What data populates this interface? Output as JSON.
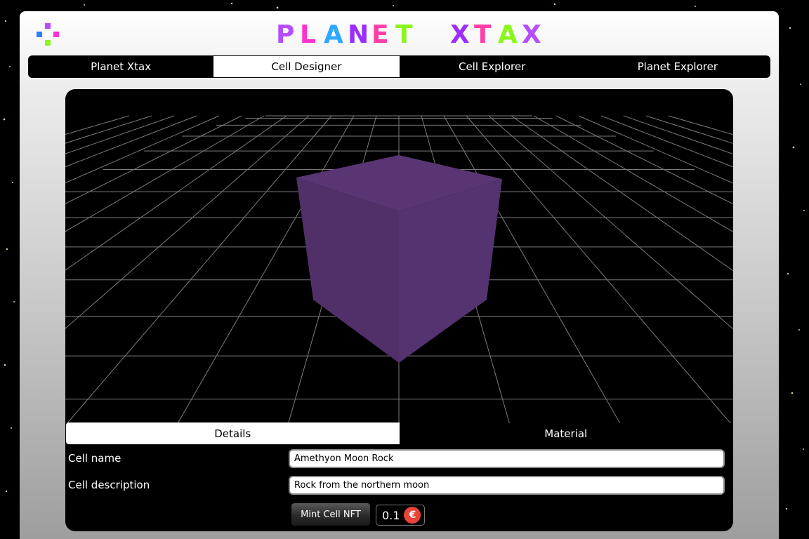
{
  "brand": {
    "title_left": "PLANET",
    "title_right": "XTAX",
    "title_colors": [
      "#b54dff",
      "#ff2fd0",
      "#2ea8ff",
      "#9b2dff",
      "#ff3fa8",
      "#8cf51a"
    ]
  },
  "nav": {
    "tabs": [
      {
        "label": "Planet Xtax",
        "active": false
      },
      {
        "label": "Cell Designer",
        "active": true
      },
      {
        "label": "Cell Explorer",
        "active": false
      },
      {
        "label": "Planet Explorer",
        "active": false
      }
    ]
  },
  "viewer": {
    "cube_color": "#52306b",
    "grid_color": "#7c7c7c"
  },
  "subtabs": [
    {
      "label": "Details",
      "active": true
    },
    {
      "label": "Material",
      "active": false
    }
  ],
  "form": {
    "name_label": "Cell name",
    "name_value": "Amethyon Moon Rock",
    "description_label": "Cell description",
    "description_value": "Rock from the northern moon",
    "mint_label": "Mint Cell NFT",
    "price": "0.1",
    "currency_icon": "coin-icon"
  }
}
